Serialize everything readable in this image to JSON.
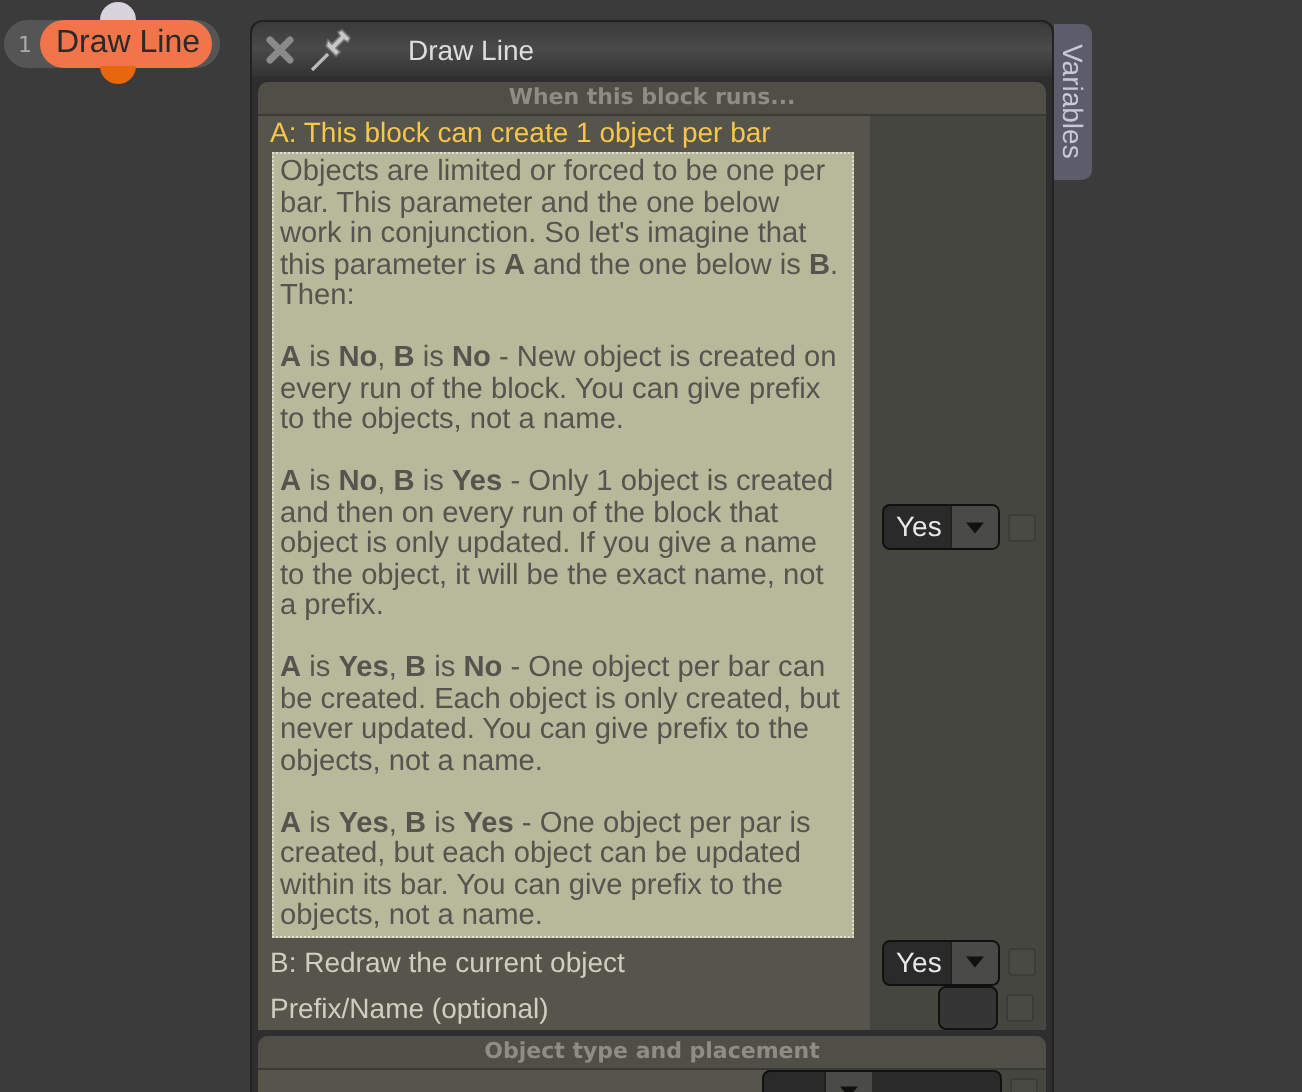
{
  "node": {
    "index": "1",
    "label": "Draw Line"
  },
  "window": {
    "title": "Draw Line",
    "side_tab": "Variables"
  },
  "sections": [
    {
      "title": "When this block runs...",
      "rows": [
        {
          "kind": "dropdown",
          "label": "A: This block can create 1 object per bar",
          "highlighted": true,
          "value": "Yes",
          "checked": false,
          "description": [
            "Objects are limited or forced to be one per bar. This parameter and the one below work in conjunction. So let's imagine that this parameter is **A** and the one below is **B**. Then:",
            "**A** is **No**, **B** is **No** - New object is created on every run of the block. You can give prefix to the objects, not a name.",
            "**A** is **No**, **B** is **Yes** - Only 1 object is created and then on every run of the block that object is only updated. If you give a name to the object, it will be the exact name, not a prefix.",
            "**A** is **Yes**, **B** is **No** - One object per bar can be created. Each object is only created, but never updated. You can give prefix to the objects, not a name.",
            "**A** is **Yes**, **B** is **Yes** - One object per par is created, but each object can be updated within its bar. You can give prefix to the objects, not a name."
          ]
        },
        {
          "kind": "dropdown",
          "label": "B: Redraw the current object",
          "highlighted": false,
          "value": "Yes",
          "checked": false
        },
        {
          "kind": "text-input",
          "label": "Prefix/Name (optional)",
          "highlighted": false,
          "checked": false
        }
      ]
    },
    {
      "title": "Object type and placement",
      "rows": [
        {
          "kind": "dropdown",
          "checked": false
        }
      ]
    }
  ]
}
